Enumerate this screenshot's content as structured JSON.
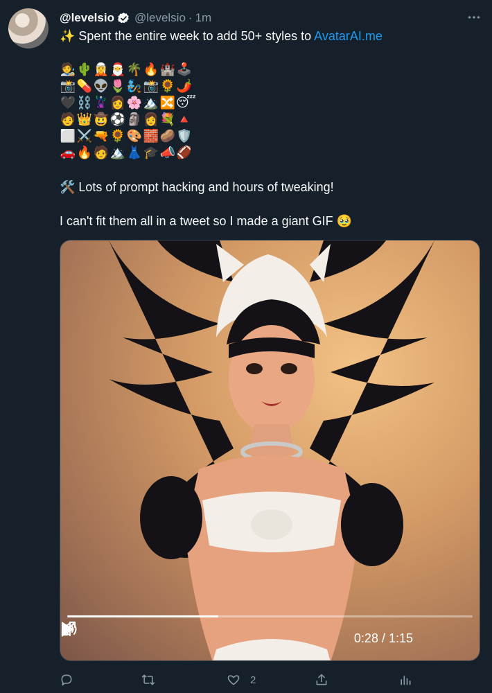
{
  "tweet": {
    "display_name": "@levelsio",
    "handle": "@levelsio",
    "separator": "·",
    "time": "1m",
    "line1_prefix": "✨ Spent the entire week to add 50+ styles to ",
    "line1_link": "AvatarAI.me",
    "emojis": [
      "🧑‍🎨",
      "🌵",
      "🧝",
      "🎅",
      "🌴",
      "🔥",
      "🏰",
      "🕹️",
      "📸",
      "💊",
      "👽",
      "🌷",
      "🧞",
      "📸",
      "🌻",
      "🌶️",
      "🖤",
      "⛓️",
      "🦹",
      "👩",
      "🌸",
      "🏔️",
      "🔀",
      "😴",
      "🧑",
      "👑",
      "🤠",
      "⚽",
      "🗿",
      "👩",
      "💐",
      "🔺",
      "⬜",
      "⚔️",
      "🔫",
      "🌻",
      "🎨",
      "🧱",
      "🥔",
      "🛡️",
      "🚗",
      "🔥",
      "🧑",
      "🏔️",
      "👗",
      "🎓",
      "📣",
      "🏈"
    ],
    "line3": "🛠️ Lots of prompt hacking and hours of tweaking!",
    "line4": "I can't fit them all in a tweet so I made a giant GIF 🥹"
  },
  "video": {
    "time_readout": "0:28 / 1:15",
    "progress": 0.373
  },
  "actions": {
    "reply_count": "",
    "retweet_count": "",
    "like_count": "2",
    "share_count": "",
    "analytics_count": ""
  },
  "colors": {
    "background": "#15202b",
    "text": "#f7f9f9",
    "muted": "#8b98a5",
    "link": "#1d9bf0",
    "verified": "#f7f9f9"
  },
  "icons": {
    "verified": "verified-badge-icon",
    "more": "more-dots-icon",
    "play": "play-icon",
    "volume": "volume-icon",
    "fullscreen": "fullscreen-icon",
    "reply": "reply-icon",
    "retweet": "retweet-icon",
    "like": "heart-icon",
    "share": "share-icon",
    "analytics": "analytics-icon"
  }
}
